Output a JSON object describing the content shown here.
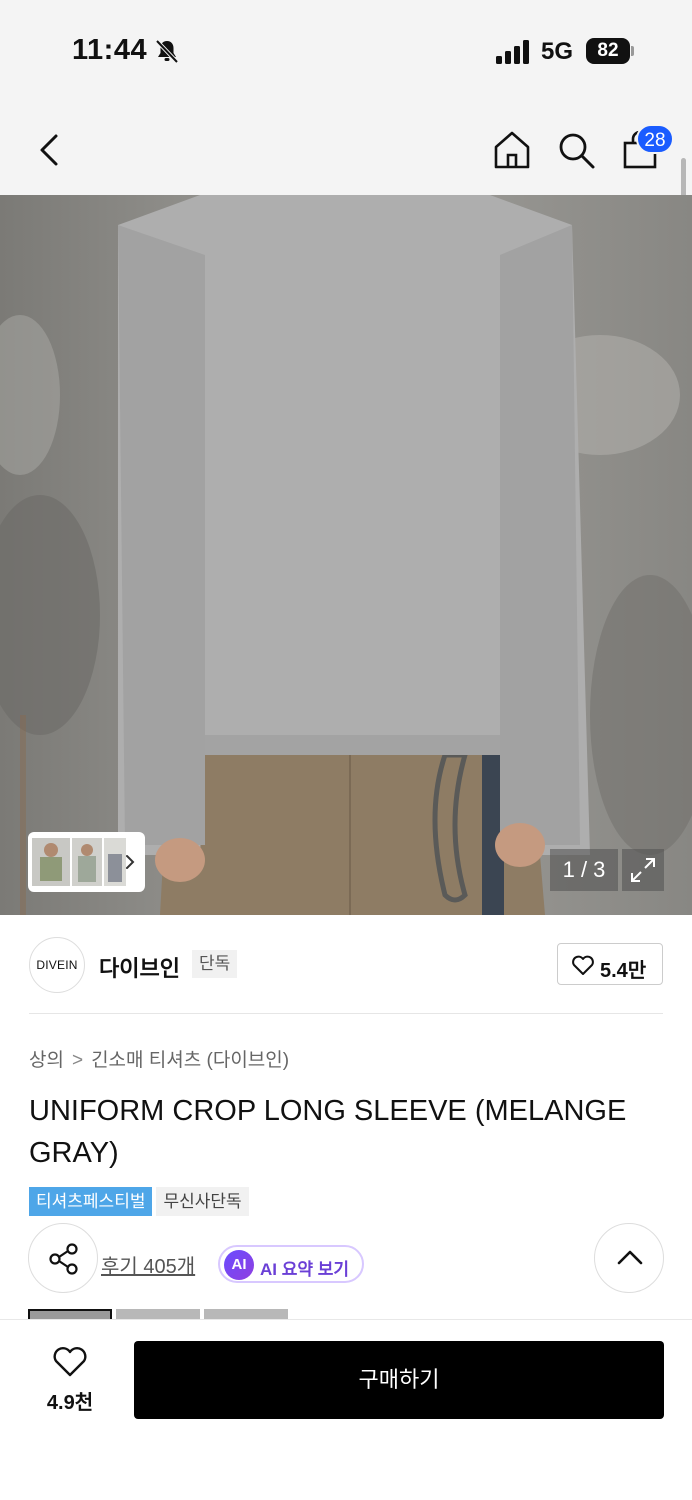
{
  "status_bar": {
    "time": "11:44",
    "network": "5G",
    "battery": "82"
  },
  "nav": {
    "cart_count": "28"
  },
  "hero": {
    "page_counter": "1 / 3"
  },
  "brand": {
    "logo_text": "DIVEIN",
    "name": "다이브인",
    "exclusive_tag": "단독",
    "like_count": "5.4만"
  },
  "breadcrumb": {
    "category": "상의",
    "separator": ">",
    "subcategory": "긴소매 티셔츠 (다이브인)"
  },
  "product": {
    "title": "UNIFORM CROP LONG SLEEVE (MELANGE GRAY)"
  },
  "tags": [
    {
      "label": "티셔츠페스티벌",
      "color": "#4ea6e8"
    },
    {
      "label": "무신사단독"
    }
  ],
  "reviews": {
    "link_label": "후기 405개",
    "ai_badge": "AI",
    "ai_summary_label": "AI 요약 보기"
  },
  "bottom_bar": {
    "wish_count": "4.9천",
    "buy_label": "구매하기"
  },
  "colors": {
    "accent_blue": "#1a5cff",
    "buy_button_bg": "#000000",
    "ai_purple": "#6a3fd6"
  },
  "icons": [
    "bell-off-icon",
    "signal-icon",
    "back-arrow-icon",
    "home-icon",
    "search-icon",
    "shopping-bag-icon",
    "chevron-right-icon",
    "expand-icon",
    "heart-icon",
    "share-icon",
    "chevron-up-icon"
  ]
}
